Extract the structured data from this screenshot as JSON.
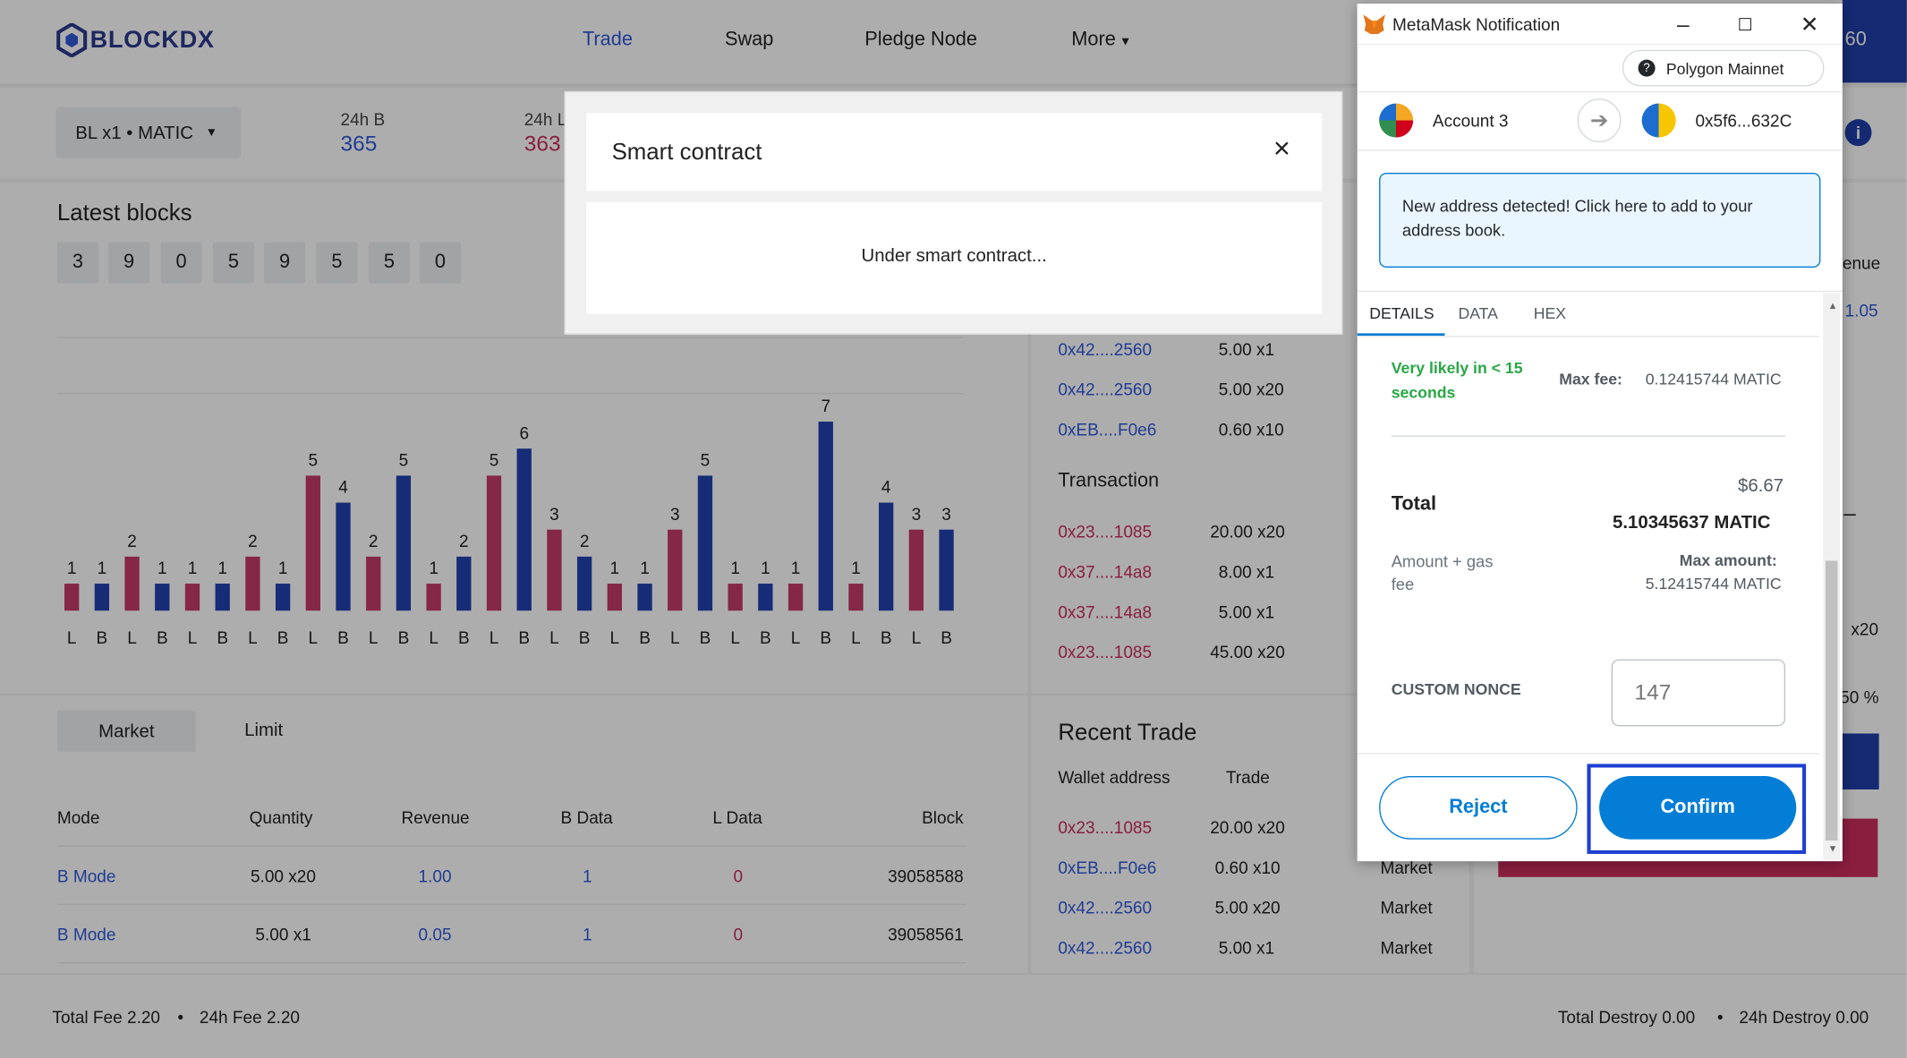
{
  "header": {
    "logo_text": "BLOCKDX",
    "nav": [
      "Trade",
      "Swap",
      "Pledge Node",
      "More"
    ],
    "corner_text": "60"
  },
  "ticker": {
    "pair": "BL x1 • MATIC",
    "stat1_label": "24h B",
    "stat1_value": "365",
    "stat2_label": "24h L",
    "stat2_value": "363"
  },
  "latest_blocks": {
    "title": "Latest blocks",
    "digits": [
      "3",
      "9",
      "0",
      "5",
      "9",
      "5",
      "5",
      "0"
    ]
  },
  "chart_data": {
    "type": "bar",
    "categories": [
      "L",
      "B",
      "L",
      "B",
      "L",
      "B",
      "L",
      "B",
      "L",
      "B",
      "L",
      "B",
      "L",
      "B",
      "L",
      "B",
      "L",
      "B",
      "L",
      "B",
      "L",
      "B",
      "L",
      "B",
      "L",
      "B",
      "L",
      "B",
      "L",
      "B"
    ],
    "values": [
      1,
      1,
      2,
      1,
      1,
      1,
      2,
      1,
      5,
      4,
      2,
      5,
      1,
      2,
      5,
      6,
      3,
      2,
      1,
      1,
      3,
      5,
      1,
      1,
      1,
      7,
      1,
      4,
      3,
      3
    ],
    "colors": {
      "L": "#c43a68",
      "B": "#2342b0"
    }
  },
  "right_mid": {
    "rows_top": [
      {
        "addr": "0x42....2560",
        "trade": "5.00 x1"
      },
      {
        "addr": "0x42....2560",
        "trade": "5.00 x20"
      },
      {
        "addr": "0xEB....F0e6",
        "trade": "0.60 x10"
      }
    ],
    "transaction_title": "Transaction",
    "transactions": [
      {
        "addr": "0x23....1085",
        "trade": "20.00 x20"
      },
      {
        "addr": "0x37....14a8",
        "trade": "8.00 x1"
      },
      {
        "addr": "0x37....14a8",
        "trade": "5.00 x1"
      },
      {
        "addr": "0x23....1085",
        "trade": "45.00 x20"
      }
    ]
  },
  "far_right": {
    "revenue_frag": "enue",
    "val_frag": "1.05",
    "dash": "–",
    "x20": "x20",
    "pct_frag": "50 %"
  },
  "orders": {
    "tabs": [
      "Market",
      "Limit"
    ],
    "columns": [
      "Mode",
      "Quantity",
      "Revenue",
      "B Data",
      "L Data",
      "Block"
    ],
    "rows": [
      {
        "mode": "B Mode",
        "qty": "5.00 x20",
        "revenue": "1.00",
        "bdata": "1",
        "ldata": "0",
        "block": "39058588"
      },
      {
        "mode": "B Mode",
        "qty": "5.00 x1",
        "revenue": "0.05",
        "bdata": "1",
        "ldata": "0",
        "block": "39058561"
      }
    ]
  },
  "recent_trade": {
    "title": "Recent Trade",
    "col_wallet": "Wallet address",
    "col_trade": "Trade",
    "rows": [
      {
        "addr": "0x23....1085",
        "trade": "20.00 x20",
        "type": ""
      },
      {
        "addr": "0xEB....F0e6",
        "trade": "0.60 x10",
        "type": "Market"
      },
      {
        "addr": "0x42....2560",
        "trade": "5.00 x20",
        "type": "Market"
      },
      {
        "addr": "0x42....2560",
        "trade": "5.00 x1",
        "type": "Market"
      }
    ]
  },
  "footer": {
    "total_fee": "Total Fee 2.20",
    "fee_24h": "24h Fee 2.20",
    "total_destroy": "Total Destroy 0.00",
    "destroy_24h": "24h Destroy 0.00",
    "bullet": "•"
  },
  "smart_contract": {
    "title": "Smart contract",
    "body": "Under smart contract..."
  },
  "metamask": {
    "window_title": "MetaMask Notification",
    "network": "Polygon Mainnet",
    "account": "Account 3",
    "to_address": "0x5f6...632C",
    "notice": "New address detected! Click here to add to your address book.",
    "tabs": [
      "DETAILS",
      "DATA",
      "HEX"
    ],
    "likely": "Very likely in < 15 seconds",
    "max_fee_label": "Max fee:",
    "max_fee_value": "0.12415744 MATIC",
    "total_label": "Total",
    "total_usd": "$6.67",
    "total_matic": "5.10345637 MATIC",
    "amount_gas_label": "Amount + gas fee",
    "max_amount_label": "Max amount:",
    "max_amount_value": "5.12415744 MATIC",
    "nonce_label": "CUSTOM NONCE",
    "nonce_placeholder": "147",
    "reject": "Reject",
    "confirm": "Confirm",
    "colors": {
      "primary": "#037dd6",
      "success": "#28a745",
      "highlight": "#1f3fd1"
    }
  }
}
